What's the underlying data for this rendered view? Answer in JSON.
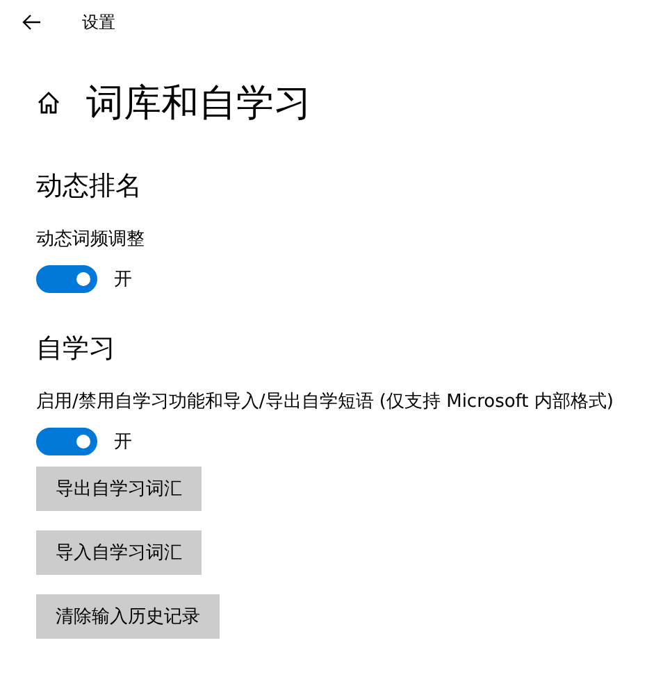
{
  "window": {
    "title": "设置"
  },
  "page": {
    "title": "词库和自学习"
  },
  "sections": [
    {
      "title": "动态排名",
      "items": [
        {
          "kind": "toggle",
          "label": "动态词频调整",
          "on": true,
          "state_text": "开"
        }
      ]
    },
    {
      "title": "自学习",
      "items": [
        {
          "kind": "toggle",
          "label": "启用/禁用自学习功能和导入/导出自学短语 (仅支持 Microsoft 内部格式)",
          "on": true,
          "state_text": "开"
        },
        {
          "kind": "button",
          "label": "导出自学习词汇"
        },
        {
          "kind": "button",
          "label": "导入自学习词汇"
        },
        {
          "kind": "button",
          "label": "清除输入历史记录"
        }
      ]
    }
  ]
}
